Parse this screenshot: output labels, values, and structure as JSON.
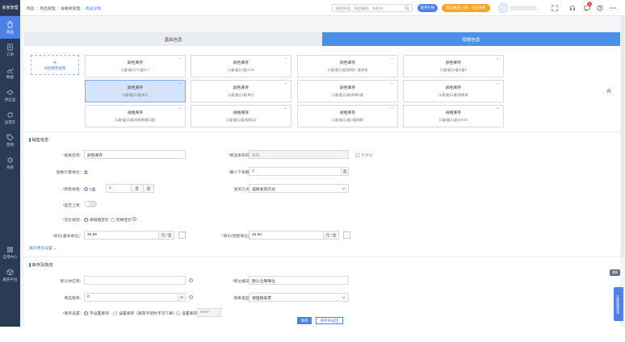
{
  "sidebar": {
    "logo": "商家管理",
    "items": [
      {
        "label": "商品",
        "icon": "bag-icon",
        "active": true
      },
      {
        "label": "订单",
        "icon": "order-icon",
        "active": false
      },
      {
        "label": "数据",
        "icon": "chart-icon",
        "active": false
      },
      {
        "label": "供应品",
        "icon": "supply-icon",
        "active": false
      },
      {
        "label": "运营在",
        "icon": "refresh-icon",
        "active": false
      },
      {
        "label": "营销",
        "icon": "tag-icon",
        "active": false
      },
      {
        "label": "系统",
        "icon": "gear-icon",
        "active": false
      }
    ],
    "bottom": [
      {
        "label": "应用中心",
        "icon": "apps-icon"
      },
      {
        "label": "服务平台",
        "icon": "cube-icon"
      }
    ]
  },
  "header": {
    "breadcrumbs": [
      "商品",
      "商品管理",
      "规格库管理",
      "商品详情"
    ],
    "search_placeholder": "搜索商品、商品编码、条形码",
    "btn_new": "新手引导",
    "btn_promo": "新品推荐上线，点击查看",
    "notification_count": "2"
  },
  "tabs": [
    {
      "label": "基础信息",
      "active": false
    },
    {
      "label": "规格信息",
      "active": true
    }
  ],
  "spec": {
    "add_label": "添加销售规格",
    "cards": [
      {
        "name": "颜色库存",
        "sub": "(1盒/盒(1)*(1盒)1-7",
        "selected": false
      },
      {
        "name": "颜色库存",
        "sub": "(1盒/盒)(1盒)1-19",
        "selected": false
      },
      {
        "name": "颜色库存",
        "sub": "(1盒/盒)(1盒)规格2, 盒规格",
        "selected": false
      },
      {
        "name": "颜色库存",
        "sub": "(1盒/盒)(1盒)1盒5",
        "selected": false
      },
      {
        "name": "颜色库存",
        "sub": "(1盒/盒)(1盒)单位",
        "selected": true
      },
      {
        "name": "颜色库存",
        "sub": "(1盒/盒)(1盒)单位",
        "selected": false
      },
      {
        "name": "颜色库存",
        "sub": "(1盒/盒)(1盒)规格5盒",
        "selected": false
      },
      {
        "name": "颜色库存",
        "sub": "(1盒/盒)(1盒)规格库",
        "selected": false
      },
      {
        "name": "规格库存",
        "sub": "(1盒/盒)(1盒)规格数量(1盒)",
        "selected": false
      },
      {
        "name": "规格库存",
        "sub": "(1盒/盒)(1盒)规格(1)",
        "selected": false
      },
      {
        "name": "规格库存",
        "sub": "(1盒/盒)(1盒)1盒规格",
        "selected": false
      },
      {
        "name": "规格库存",
        "sub": "(1盒/盒)(1盒)XXXX",
        "selected": false
      }
    ]
  },
  "sales": {
    "section_title": "销售信息",
    "spec_name_label": "规格名称:",
    "spec_name_value": "颜色库存",
    "barcode_label": "*商品条形码:",
    "barcode_value": "条码",
    "barcode_check_label": "无条码",
    "sale_price_label": "按数计量单位:",
    "sale_price_value": "盒",
    "min_qty_label": "*最小下单数:",
    "min_qty_value": "1",
    "min_qty_unit": "盒",
    "unit_label": "*销售规格:",
    "unit_radio": "1盒",
    "unit_qty": "1",
    "unit_a": "盒",
    "unit_b": "盒",
    "ship_label": "发货方式:",
    "ship_value": "选择发货方式",
    "online_label": "*是否上架:",
    "online_toggle": "关闭",
    "price_mode_label": "*定价规则:",
    "price_mode_a": "单规格定价",
    "price_mode_b": "阶梯定价",
    "base_price_label": "*单价(基本单位):",
    "base_price_value": "45.60",
    "base_price_unit": "元 / 盒",
    "sale_unit_price_label": "*单价(销售单位):",
    "sale_unit_price_value": "45.60",
    "sale_unit_price_unit": "元 / 盒",
    "more_link": "展开更多设置"
  },
  "stock": {
    "section_title": "库存及物流",
    "supplier_label": "默认供应商:",
    "supplier_value": "",
    "location_label": "*库位编号:",
    "location_value": "默认仓库库位",
    "rate_label": "商品税率:",
    "rate_value": "0",
    "rate_unit": "%",
    "tax_label": "税率类型:",
    "tax_value": "增值税发票",
    "stock_label": "*库存设置:",
    "stock_opt_a": "不设置库存",
    "stock_opt_b": "设置库存（库存不足时不可下单）",
    "stock_opt_c": "设置库存",
    "stock_value": "9999"
  },
  "footer": {
    "save": "保存",
    "save_return": "保存并返回"
  },
  "floating": {
    "side_label": "客服",
    "side_tab": "在线客服咨询"
  },
  "colors": {
    "primary": "#4d80e8",
    "sidebar": "#2b3a55",
    "promo": "#f5a623",
    "selected_card": "#d3e4fb"
  }
}
